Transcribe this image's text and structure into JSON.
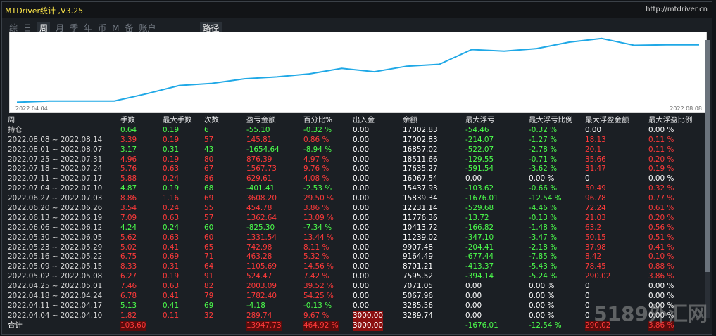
{
  "app": {
    "title": "MTDriver统计 ,V3.25",
    "url": "http://mtdriver.cn"
  },
  "tabs": [
    {
      "label": "综",
      "active": false
    },
    {
      "label": "日",
      "active": false
    },
    {
      "label": "周",
      "active": true
    },
    {
      "label": "月",
      "active": false
    },
    {
      "label": "季",
      "active": false
    },
    {
      "label": "年",
      "active": false
    },
    {
      "label": "币",
      "active": false
    },
    {
      "label": "M",
      "active": false
    },
    {
      "label": "备",
      "active": false
    },
    {
      "label": "账户",
      "active": false
    }
  ],
  "route_tab": "路径",
  "chart_meta": {
    "start_date": "2022.04.04",
    "end_date": "2022.08.08"
  },
  "table": {
    "headers": [
      "周",
      "手数",
      "最大手数",
      "次数",
      "盈亏金额",
      "百分比%",
      "出入金",
      "余额",
      "最大浮亏",
      "最大浮亏比例",
      "最大浮盈金额",
      "最大浮盈比例"
    ],
    "rows": [
      [
        "持仓",
        "0.64",
        "0.19",
        "6",
        "-55.10",
        "-0.32 %",
        "0.00",
        "17002.83",
        "-54.46",
        "-0.32 %",
        "0.00",
        "0.00 %"
      ],
      [
        "2022.08.08 ~ 2022.08.14",
        "3.39",
        "0.19",
        "57",
        "145.81",
        "0.86 %",
        "0.00",
        "17002.83",
        "-214.07",
        "-1.27 %",
        "18.13",
        "0.11 %"
      ],
      [
        "2022.08.01 ~ 2022.08.07",
        "3.17",
        "0.31",
        "43",
        "-1654.64",
        "-8.94 %",
        "0.00",
        "16857.02",
        "-522.07",
        "-2.78 %",
        "20.1",
        "0.11 %"
      ],
      [
        "2022.07.25 ~ 2022.07.31",
        "4.96",
        "0.19",
        "80",
        "876.39",
        "4.97 %",
        "0.00",
        "18511.66",
        "-129.55",
        "-0.71 %",
        "35.66",
        "0.20 %"
      ],
      [
        "2022.07.18 ~ 2022.07.24",
        "5.76",
        "0.63",
        "67",
        "1567.73",
        "9.76 %",
        "0.00",
        "17635.27",
        "-591.54",
        "-3.62 %",
        "31.47",
        "0.19 %"
      ],
      [
        "2022.07.11 ~ 2022.07.17",
        "5.88",
        "0.24",
        "86",
        "629.61",
        "4.08 %",
        "0.00",
        "16067.54",
        "0.00",
        "0.00 %",
        "0",
        "0.00 %"
      ],
      [
        "2022.07.04 ~ 2022.07.10",
        "4.87",
        "0.19",
        "68",
        "-401.41",
        "-2.53 %",
        "0.00",
        "15437.93",
        "-103.62",
        "-0.66 %",
        "50.49",
        "0.32 %"
      ],
      [
        "2022.06.27 ~ 2022.07.03",
        "8.86",
        "1.16",
        "69",
        "3608.20",
        "29.50 %",
        "0.00",
        "15839.34",
        "-1676.01",
        "-12.54 %",
        "96.78",
        "0.77 %"
      ],
      [
        "2022.06.20 ~ 2022.06.26",
        "3.54",
        "0.24",
        "55",
        "454.78",
        "3.86 %",
        "0.00",
        "12231.14",
        "-529.68",
        "-4.46 %",
        "72.24",
        "0.61 %"
      ],
      [
        "2022.06.13 ~ 2022.06.19",
        "7.09",
        "0.63",
        "57",
        "1362.64",
        "13.09 %",
        "0.00",
        "11776.36",
        "-13.72",
        "-0.13 %",
        "21.03",
        "0.20 %"
      ],
      [
        "2022.06.06 ~ 2022.06.12",
        "4.24",
        "0.24",
        "60",
        "-825.30",
        "-7.34 %",
        "0.00",
        "10413.72",
        "-166.82",
        "-1.48 %",
        "63.2",
        "0.56 %"
      ],
      [
        "2022.05.30 ~ 2022.06.05",
        "5.62",
        "0.63",
        "60",
        "1331.54",
        "13.44 %",
        "0.00",
        "11239.02",
        "-347.10",
        "-3.47 %",
        "50.15",
        "0.51 %"
      ],
      [
        "2022.05.23 ~ 2022.05.29",
        "5.02",
        "0.41",
        "65",
        "742.98",
        "8.11 %",
        "0.00",
        "9907.48",
        "-204.41",
        "-2.18 %",
        "37.98",
        "0.41 %"
      ],
      [
        "2022.05.16 ~ 2022.05.22",
        "6.75",
        "0.69",
        "71",
        "463.28",
        "5.32 %",
        "0.00",
        "9164.49",
        "-677.44",
        "-7.85 %",
        "8.42",
        "0.10 %"
      ],
      [
        "2022.05.09 ~ 2022.05.15",
        "8.33",
        "0.31",
        "64",
        "1105.69",
        "14.56 %",
        "0.00",
        "8701.21",
        "-413.37",
        "-5.43 %",
        "78.45",
        "0.88 %"
      ],
      [
        "2022.05.02 ~ 2022.05.08",
        "6.27",
        "0.19",
        "91",
        "524.47",
        "7.42 %",
        "0.00",
        "7595.52",
        "-394.14",
        "-5.24 %",
        "290.02",
        "3.86 %"
      ],
      [
        "2022.04.25 ~ 2022.05.01",
        "7.46",
        "0.63",
        "82",
        "2003.09",
        "39.52 %",
        "0.00",
        "7071.05",
        "0.00",
        "0.00 %",
        "0",
        "0.00 %"
      ],
      [
        "2022.04.18 ~ 2022.04.24",
        "6.78",
        "0.41",
        "79",
        "1782.40",
        "54.25 %",
        "0.00",
        "5067.96",
        "0.00",
        "0.00 %",
        "0",
        "0.00 %"
      ],
      [
        "2022.04.11 ~ 2022.04.17",
        "5.13",
        "0.41",
        "69",
        "-4.18",
        "-0.13 %",
        "0.00",
        "3285.56",
        "0.00",
        "0.00 %",
        "0",
        "0.00 %"
      ],
      [
        "2022.04.04 ~ 2022.04.10",
        "1.82",
        "0.11",
        "32",
        "289.74",
        "9.67 %",
        "3000.00",
        "3289.74",
        "0.00",
        "0.00 %",
        "0",
        "0.00 %"
      ]
    ],
    "total": [
      "合计",
      "103.60",
      "",
      "",
      "13947.73",
      "464.92 %",
      "3000.00",
      "",
      "-1676.01",
      "-12.54 %",
      "290.02",
      "3.86 %"
    ]
  },
  "chart_data": {
    "type": "line",
    "series": [
      {
        "values": [
          3000,
          3290,
          3286,
          3286,
          5068,
          7071,
          7596,
          8701,
          9164,
          9907,
          11239,
          10414,
          11776,
          12231,
          15839,
          15438,
          16068,
          17635,
          18512,
          16857,
          17003,
          17003
        ]
      }
    ],
    "ylim": [
      2900,
      19000
    ]
  },
  "watermark": "5189外汇网",
  "colors": {
    "equity_line": "#1fa8e6",
    "positive": "#ff3a3a",
    "negative": "#4cff4c",
    "highlight": "#8b0f0f"
  }
}
